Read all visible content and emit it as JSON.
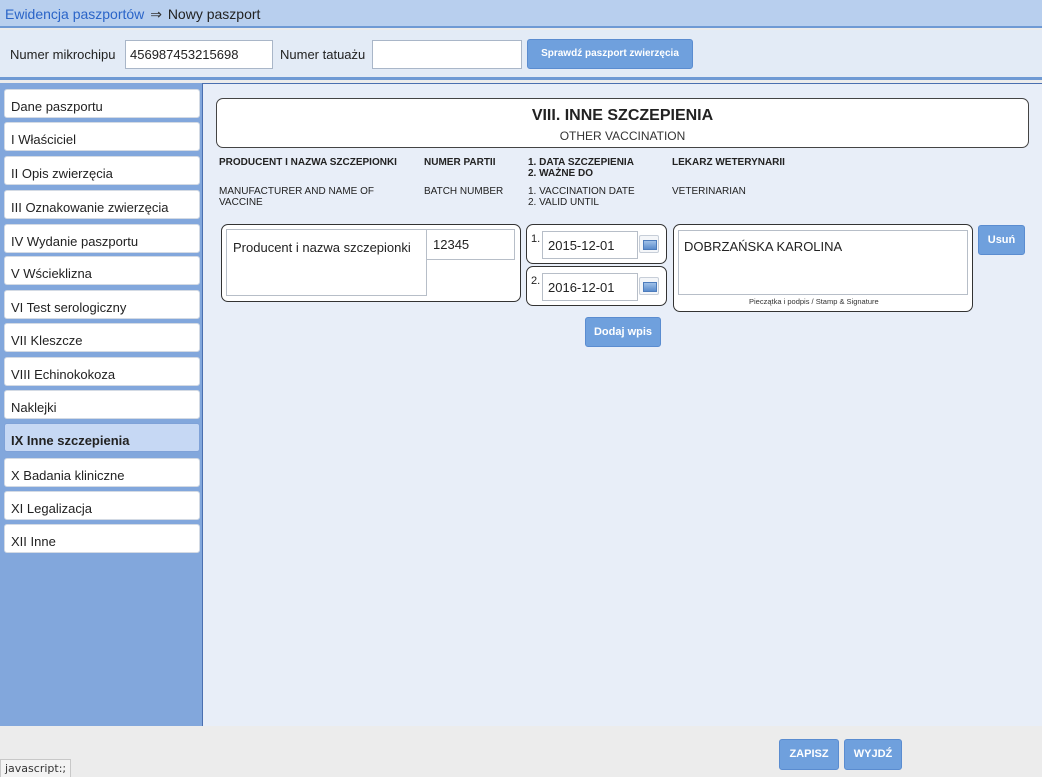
{
  "breadcrumb": {
    "link": "Ewidencja paszportów",
    "separator": "⇒",
    "current": "Nowy paszport"
  },
  "search": {
    "microchip_label": "Numer mikrochipu",
    "microchip_value": "456987453215698",
    "tattoo_label": "Numer tatuażu",
    "tattoo_value": "",
    "check_button": "Sprawdź paszport zwierzęcia"
  },
  "sidebar": {
    "items": [
      {
        "label": "Dane paszportu"
      },
      {
        "label": "I Właściciel"
      },
      {
        "label": "II Opis zwierzęcia"
      },
      {
        "label": "III Oznakowanie zwierzęcia"
      },
      {
        "label": "IV Wydanie paszportu"
      },
      {
        "label": "V Wścieklizna"
      },
      {
        "label": "VI Test serologiczny"
      },
      {
        "label": "VII Kleszcze"
      },
      {
        "label": "VIII Echinokokoza"
      },
      {
        "label": "Naklejki"
      },
      {
        "label": "IX Inne szczepienia",
        "active": true
      },
      {
        "label": "X Badania kliniczne"
      },
      {
        "label": "XI Legalizacja"
      },
      {
        "label": "XII Inne"
      }
    ]
  },
  "section": {
    "title": "VIII. INNE SZCZEPIENIA",
    "subtitle": "OTHER VACCINATION"
  },
  "columns": {
    "producer_pl": "PRODUCENT I NAZWA SZCZEPIONKI",
    "producer_en": "MANUFACTURER AND NAME OF VACCINE",
    "batch_pl": "NUMER PARTII",
    "batch_en": "BATCH NUMBER",
    "date_pl_1": "1. DATA SZCZEPIENIA",
    "date_pl_2": "2. WAŻNE DO",
    "date_en_1": "1. VACCINATION DATE",
    "date_en_2": "2. VALID UNTIL",
    "vet_pl": "LEKARZ WETERYNARII",
    "vet_en": "VETERINARIAN"
  },
  "entry": {
    "producer": "Producent i nazwa szczepionki",
    "batch": "12345",
    "date1_num": "1.",
    "date1": "2015-12-01",
    "date2_num": "2.",
    "date2": "2016-12-01",
    "vet": "DOBRZAŃSKA KAROLINA",
    "stamp_label": "Pieczątka i podpis / Stamp & Signature",
    "remove_button": "Usuń"
  },
  "add_button": "Dodaj wpis",
  "footer": {
    "save_button": "ZAPISZ",
    "exit_button": "WYJDŹ",
    "status_text": "javascript:;"
  }
}
